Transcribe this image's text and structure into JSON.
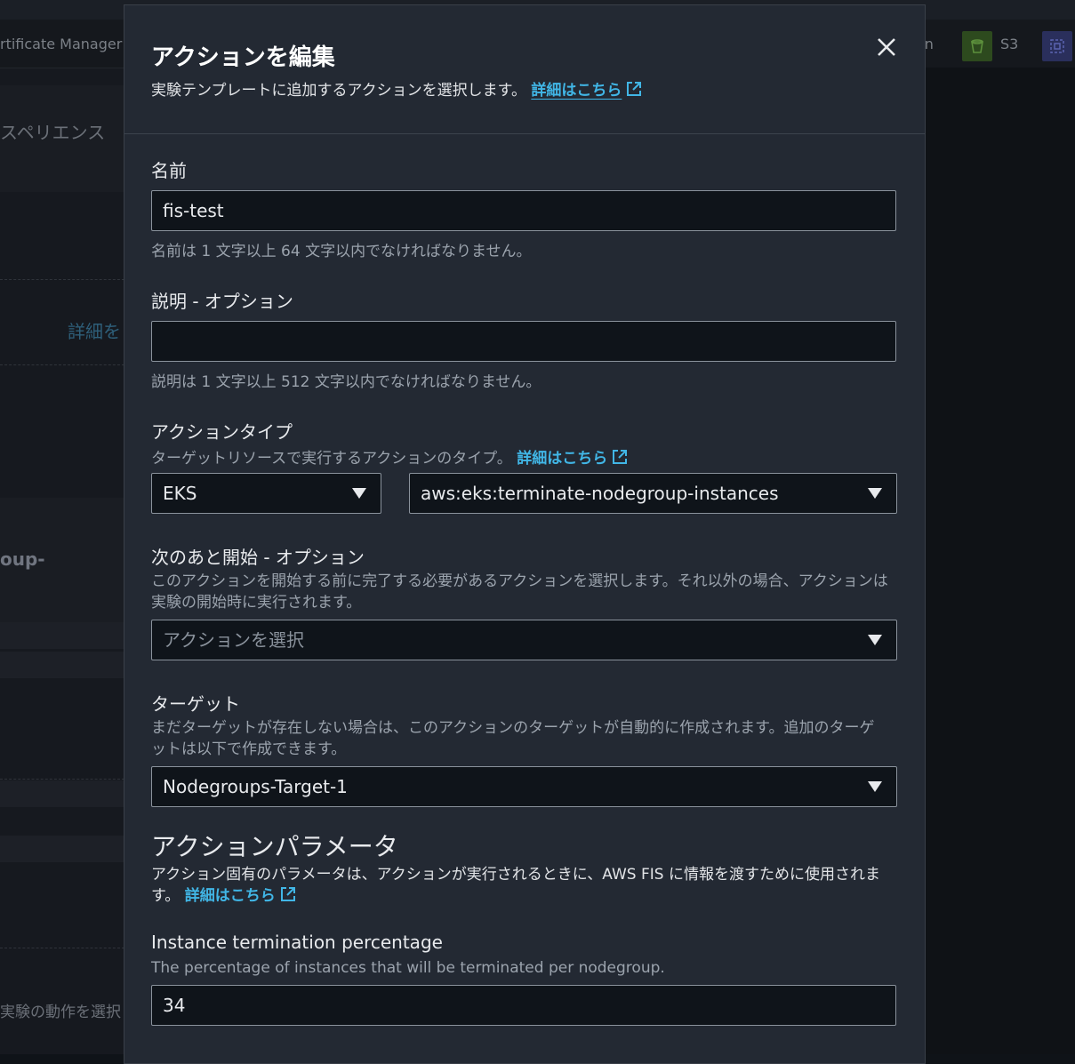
{
  "background": {
    "nav_cert": "rtificate Manager",
    "nav_partial": "on",
    "nav_s3": "S3",
    "experience_text": "スペリエンス",
    "detail_link": "詳細を",
    "group_text": "oup-",
    "bottom_text": "実験の動作を選択し"
  },
  "modal": {
    "title": "アクションを編集",
    "subtitle": "実験テンプレートに追加するアクションを選択します。",
    "learn_more": "詳細はこちら",
    "close_icon": "close-icon",
    "name": {
      "label": "名前",
      "value": "fis-test",
      "hint": "名前は 1 文字以上 64 文字以内でなければなりません。"
    },
    "description": {
      "label": "説明 - オプション",
      "value": "",
      "hint": "説明は 1 文字以上 512 文字以内でなければなりません。"
    },
    "action_type": {
      "label": "アクションタイプ",
      "hint": "ターゲットリソースで実行するアクションのタイプ。",
      "learn_more": "詳細はこちら",
      "service_value": "EKS",
      "action_value": "aws:eks:terminate-nodegroup-instances"
    },
    "start_after": {
      "label": "次のあと開始 - オプション",
      "hint": "このアクションを開始する前に完了する必要があるアクションを選択します。それ以外の場合、アクションは実験の開始時に実行されます。",
      "placeholder": "アクションを選択"
    },
    "target": {
      "label": "ターゲット",
      "hint": "まだターゲットが存在しない場合は、このアクションのターゲットが自動的に作成されます。追加のターゲットは以下で作成できます。",
      "value": "Nodegroups-Target-1"
    },
    "params": {
      "title": "アクションパラメータ",
      "description": "アクション固有のパラメータは、アクションが実行されるときに、AWS FIS に情報を渡すために使用されます。",
      "learn_more": "詳細はこちら"
    },
    "termination": {
      "label": "Instance termination percentage",
      "hint": "The percentage of instances that will be terminated per nodegroup.",
      "value": "34"
    }
  }
}
